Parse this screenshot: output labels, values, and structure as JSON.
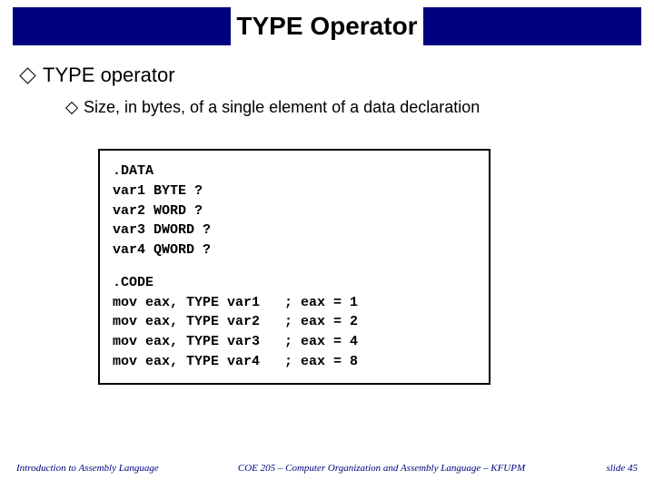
{
  "title": "TYPE Operator",
  "bullet": "TYPE operator",
  "sub_bullet": "Size, in bytes, of a single element of a data declaration",
  "code": {
    "data_section": ".DATA\nvar1 BYTE ?\nvar2 WORD ?\nvar3 DWORD ?\nvar4 QWORD ?",
    "code_section": ".CODE\nmov eax, TYPE var1   ; eax = 1\nmov eax, TYPE var2   ; eax = 2\nmov eax, TYPE var3   ; eax = 4\nmov eax, TYPE var4   ; eax = 8"
  },
  "footer": {
    "left": "Introduction to Assembly Language",
    "middle": "COE 205 – Computer Organization and Assembly Language – KFUPM",
    "right": "slide 45"
  }
}
